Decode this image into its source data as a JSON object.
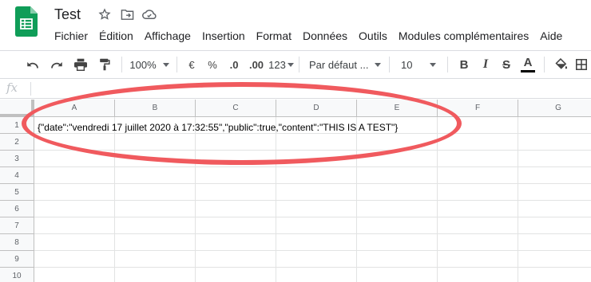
{
  "doc": {
    "title": "Test"
  },
  "menu": [
    "Fichier",
    "Édition",
    "Affichage",
    "Insertion",
    "Format",
    "Données",
    "Outils",
    "Modules complémentaires",
    "Aide"
  ],
  "toolbar": {
    "zoom": "100%",
    "currency": "€",
    "percent": "%",
    "decrease_decimals": ".0",
    "increase_decimals": ".00",
    "more_formats": "123",
    "font": "Par défaut ...",
    "font_size": "10",
    "bold": "B",
    "italic": "I",
    "strikethrough": "S",
    "text_color": "A"
  },
  "formula_bar": {
    "fx": "fx",
    "value": ""
  },
  "columns": [
    "A",
    "B",
    "C",
    "D",
    "E",
    "F",
    "G"
  ],
  "rows": [
    "1",
    "2",
    "3",
    "4",
    "5",
    "6",
    "7",
    "8",
    "9",
    "10"
  ],
  "cells": {
    "A1": "{\"date\":\"vendredi 17 juillet 2020 à 17:32:55\",\"public\":true,\"content\":\"THIS IS A TEST\"}"
  },
  "annotation_color": "#f05a5e",
  "brand_color": "#0f9d58"
}
